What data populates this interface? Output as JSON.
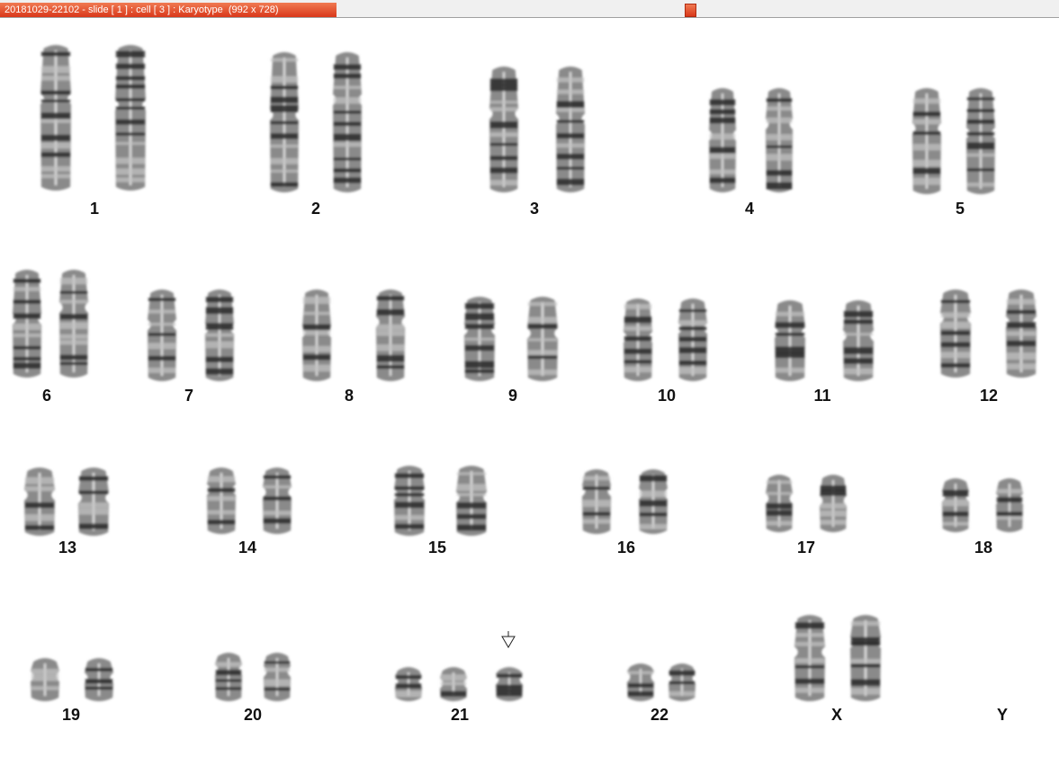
{
  "window": {
    "title": "20181029-22102 - slide [ 1 ] : cell [ 3 ] : Karyotype  (992 x 728)",
    "accent_color": "#e0441f"
  },
  "karyotype": {
    "marker": "down-arrow-icon",
    "chromosomes": [
      {
        "label": "1",
        "copies": 2
      },
      {
        "label": "2",
        "copies": 2
      },
      {
        "label": "3",
        "copies": 2
      },
      {
        "label": "4",
        "copies": 2
      },
      {
        "label": "5",
        "copies": 2
      },
      {
        "label": "6",
        "copies": 2
      },
      {
        "label": "7",
        "copies": 2
      },
      {
        "label": "8",
        "copies": 2
      },
      {
        "label": "9",
        "copies": 2
      },
      {
        "label": "10",
        "copies": 2
      },
      {
        "label": "11",
        "copies": 2
      },
      {
        "label": "12",
        "copies": 2
      },
      {
        "label": "13",
        "copies": 2
      },
      {
        "label": "14",
        "copies": 2
      },
      {
        "label": "15",
        "copies": 2
      },
      {
        "label": "16",
        "copies": 2
      },
      {
        "label": "17",
        "copies": 2
      },
      {
        "label": "18",
        "copies": 2
      },
      {
        "label": "19",
        "copies": 2
      },
      {
        "label": "20",
        "copies": 2
      },
      {
        "label": "21",
        "copies": 3
      },
      {
        "label": "22",
        "copies": 2
      },
      {
        "label": "X",
        "copies": 2
      },
      {
        "label": "Y",
        "copies": 0
      }
    ]
  }
}
